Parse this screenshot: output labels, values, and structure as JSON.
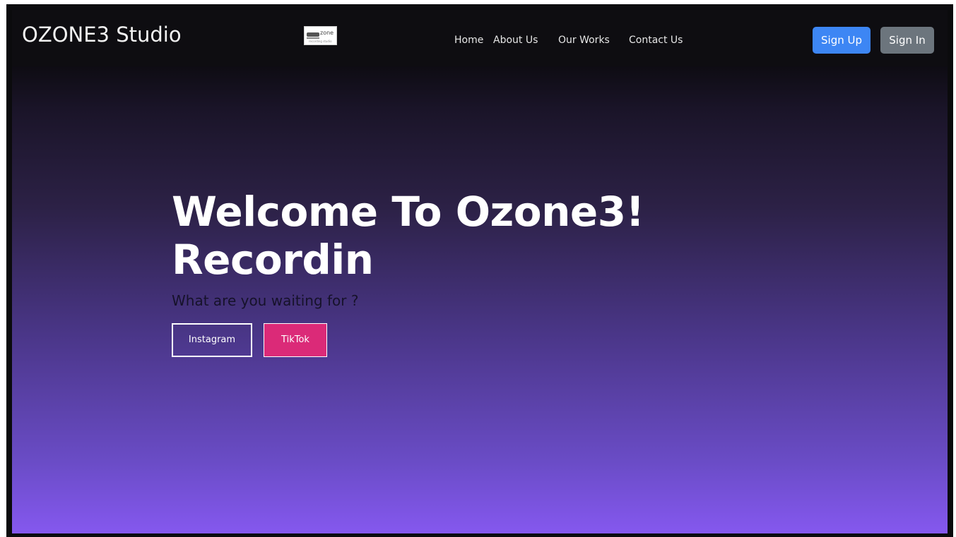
{
  "navbar": {
    "brand": "OZONE3 Studio",
    "logo": {
      "text": "zone",
      "subtext": "recording studio"
    },
    "links": [
      {
        "label": "Home"
      },
      {
        "label": "About Us"
      },
      {
        "label": "Our Works"
      },
      {
        "label": "Contact Us"
      }
    ],
    "signup_label": "Sign Up",
    "signin_label": "Sign In"
  },
  "hero": {
    "title_line1": "Welcome To Ozone3!",
    "title_line2": "Recordin",
    "subtitle": "What are you waiting for ?",
    "instagram_label": "Instagram",
    "tiktok_label": "TikTok"
  },
  "colors": {
    "navbar_bg": "#0e0d11",
    "signup_bg": "#3d86f4",
    "signin_bg": "#6c757d",
    "tiktok_bg": "#db2a78",
    "gradient_top": "#0e0c13",
    "gradient_bottom": "#8558ef"
  }
}
